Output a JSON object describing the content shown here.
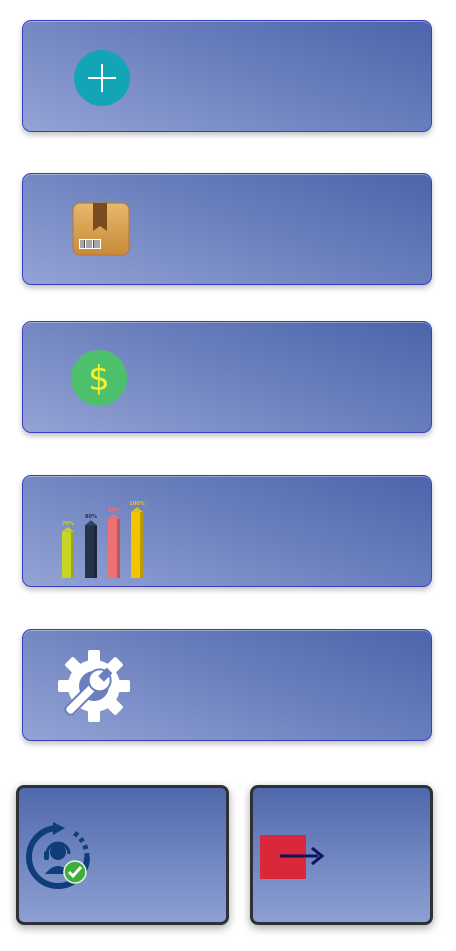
{
  "menu": {
    "tiles": [
      {
        "id": "add",
        "icon": "plus-circle-icon"
      },
      {
        "id": "inventory",
        "icon": "package-box-icon"
      },
      {
        "id": "sales",
        "icon": "dollar-circle-icon"
      },
      {
        "id": "reports",
        "icon": "bar-chart-icon"
      },
      {
        "id": "settings",
        "icon": "gear-wrench-icon"
      }
    ],
    "bottom": [
      {
        "id": "support",
        "icon": "support-headset-icon"
      },
      {
        "id": "logout",
        "icon": "exit-arrow-icon"
      }
    ]
  },
  "reports_icon": {
    "bar_labels": [
      "70%",
      "80%",
      "90%",
      "100%"
    ],
    "bar_colors": [
      "#c7d622",
      "#25334a",
      "#ee7273",
      "#f2c500"
    ]
  },
  "colors": {
    "tile_border": "#3a3fc0",
    "plus_circle": "#13a5b5",
    "dollar_circle": "#4cc06a",
    "dollar_sign": "#f6ee2e",
    "exit_square": "#d9283a",
    "exit_arrow": "#13105a"
  }
}
